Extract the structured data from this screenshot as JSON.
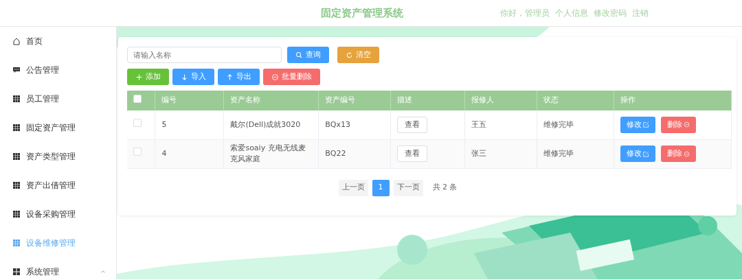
{
  "header": {
    "title": "固定资产管理系统",
    "links": [
      "你好，管理员",
      "个人信息",
      "修改密码",
      "注销"
    ]
  },
  "sidebar": {
    "items": [
      {
        "label": "首页",
        "kind": "home",
        "selected": false
      },
      {
        "label": "公告管理",
        "kind": "notice",
        "selected": false
      },
      {
        "label": "员工管理",
        "kind": "page",
        "selected": false
      },
      {
        "label": "固定资产管理",
        "kind": "page",
        "selected": false
      },
      {
        "label": "资产类型管理",
        "kind": "page",
        "selected": false
      },
      {
        "label": "资产出借管理",
        "kind": "page",
        "selected": false
      },
      {
        "label": "设备采购管理",
        "kind": "page",
        "selected": false
      },
      {
        "label": "设备维修管理",
        "kind": "page",
        "selected": true
      },
      {
        "label": "系统管理",
        "kind": "group",
        "selected": false,
        "expanded": true
      }
    ]
  },
  "search": {
    "placeholder": "请输入名称",
    "buttons": [
      {
        "label": "查询",
        "kind": "search"
      },
      {
        "label": "清空",
        "kind": "reset"
      }
    ]
  },
  "toolbar": [
    {
      "label": "添加",
      "kind": "add"
    },
    {
      "label": "导入",
      "kind": "import"
    },
    {
      "label": "导出",
      "kind": "export"
    },
    {
      "label": "批量删除",
      "kind": "delete"
    }
  ],
  "table": {
    "all_checked": false,
    "columns": [
      "编号",
      "资产名称",
      "资产编号",
      "描述",
      "报修人",
      "状态",
      "操作"
    ],
    "rows": [
      {
        "checked": false,
        "cells": [
          "5",
          "戴尔(Dell)成就3020",
          "BQx13"
        ],
        "view": "查看",
        "reporter": "王五",
        "status": "维修完毕",
        "edit": "修改",
        "delete": "删除"
      },
      {
        "checked": false,
        "cells": [
          "4",
          "索爱soaiy 充电无线麦克风家庭",
          "BQ22"
        ],
        "view": "查看",
        "reporter": "张三",
        "status": "维修完毕",
        "edit": "修改",
        "delete": "删除"
      }
    ]
  },
  "pagination": {
    "prev": "上一页",
    "pages": [
      {
        "label": "1",
        "selected": true
      }
    ],
    "next": "下一页",
    "total": "共 2 条"
  }
}
